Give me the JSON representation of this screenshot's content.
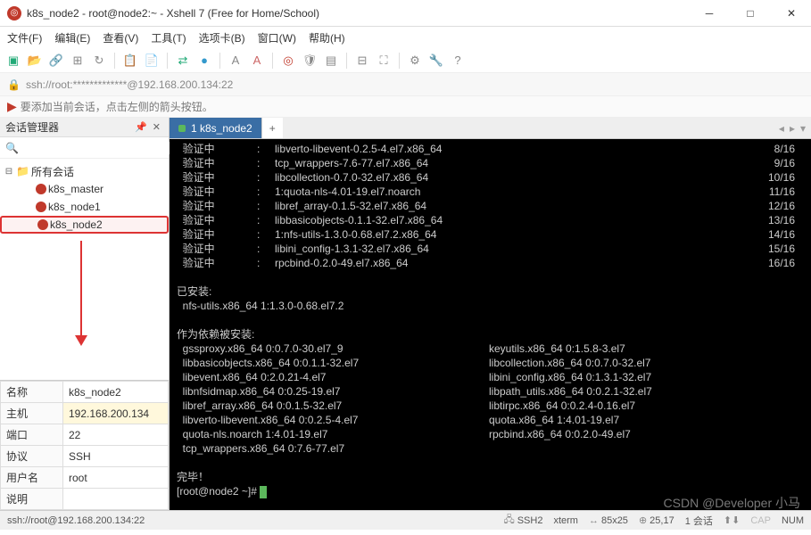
{
  "window": {
    "title": "k8s_node2 - root@node2:~ - Xshell 7 (Free for Home/School)"
  },
  "menu": {
    "file": "文件(F)",
    "edit": "编辑(E)",
    "view": "查看(V)",
    "tools": "工具(T)",
    "tabs": "选项卡(B)",
    "window": "窗口(W)",
    "help": "帮助(H)"
  },
  "addressbar": {
    "text": "ssh://root:*************@192.168.200.134:22"
  },
  "hint": {
    "text": "要添加当前会话，点击左侧的箭头按钮。"
  },
  "sidebar": {
    "title": "会话管理器",
    "root": "所有会话",
    "items": [
      "k8s_master",
      "k8s_node1",
      "k8s_node2"
    ]
  },
  "props": {
    "rows": [
      {
        "k": "名称",
        "v": "k8s_node2"
      },
      {
        "k": "主机",
        "v": "192.168.200.134"
      },
      {
        "k": "端口",
        "v": "22"
      },
      {
        "k": "协议",
        "v": "SSH"
      },
      {
        "k": "用户名",
        "v": "root"
      },
      {
        "k": "说明",
        "v": ""
      }
    ]
  },
  "tab": {
    "label": "1 k8s_node2"
  },
  "terminal": {
    "verify": "验证中",
    "lines": [
      {
        "pkg": "libverto-libevent-0.2.5-4.el7.x86_64",
        "n": "8/16"
      },
      {
        "pkg": "tcp_wrappers-7.6-77.el7.x86_64",
        "n": "9/16"
      },
      {
        "pkg": "libcollection-0.7.0-32.el7.x86_64",
        "n": "10/16"
      },
      {
        "pkg": "1:quota-nls-4.01-19.el7.noarch",
        "n": "11/16"
      },
      {
        "pkg": "libref_array-0.1.5-32.el7.x86_64",
        "n": "12/16"
      },
      {
        "pkg": "libbasicobjects-0.1.1-32.el7.x86_64",
        "n": "13/16"
      },
      {
        "pkg": "1:nfs-utils-1.3.0-0.68.el7.2.x86_64",
        "n": "14/16"
      },
      {
        "pkg": "libini_config-1.3.1-32.el7.x86_64",
        "n": "15/16"
      },
      {
        "pkg": "rpcbind-0.2.0-49.el7.x86_64",
        "n": "16/16"
      }
    ],
    "installed_hdr": "已安装:",
    "installed": "  nfs-utils.x86_64 1:1.3.0-0.68.el7.2",
    "deps_hdr": "作为依赖被安装:",
    "deps": [
      {
        "a": "  gssproxy.x86_64 0:0.7.0-30.el7_9",
        "b": "keyutils.x86_64 0:1.5.8-3.el7"
      },
      {
        "a": "  libbasicobjects.x86_64 0:0.1.1-32.el7",
        "b": "libcollection.x86_64 0:0.7.0-32.el7"
      },
      {
        "a": "  libevent.x86_64 0:2.0.21-4.el7",
        "b": "libini_config.x86_64 0:1.3.1-32.el7"
      },
      {
        "a": "  libnfsidmap.x86_64 0:0.25-19.el7",
        "b": "libpath_utils.x86_64 0:0.2.1-32.el7"
      },
      {
        "a": "  libref_array.x86_64 0:0.1.5-32.el7",
        "b": "libtirpc.x86_64 0:0.2.4-0.16.el7"
      },
      {
        "a": "  libverto-libevent.x86_64 0:0.2.5-4.el7",
        "b": "quota.x86_64 1:4.01-19.el7"
      },
      {
        "a": "  quota-nls.noarch 1:4.01-19.el7",
        "b": "rpcbind.x86_64 0:0.2.0-49.el7"
      },
      {
        "a": "  tcp_wrappers.x86_64 0:7.6-77.el7",
        "b": ""
      }
    ],
    "done": "完毕！",
    "prompt": "[root@node2 ~]# "
  },
  "status": {
    "left": "ssh://root@192.168.200.134:22",
    "ssh": "SSH2",
    "term": "xterm",
    "size": "85x25",
    "pos": "25,17",
    "sess": "1 会话",
    "cap": "CAP",
    "num": "NUM"
  },
  "watermark": "CSDN @Developer 小马"
}
